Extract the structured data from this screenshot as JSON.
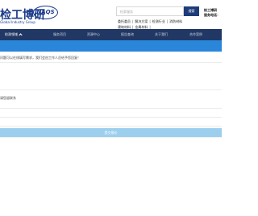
{
  "header": {
    "logo_text": "检工博研",
    "logo_sub": "Global Industry Group",
    "badge": "NAQS",
    "search": {
      "placeholder": "检索服务",
      "button": "搜索"
    },
    "hot_links_row1": [
      "委托委员",
      "解决方案",
      "检测行业",
      "消防材料"
    ],
    "hot_links_row2": [
      "建筑材料",
      "金属材料"
    ],
    "contact_line1": "检工博研",
    "contact_line2": "服务电话："
  },
  "nav": {
    "items": [
      {
        "label": "检测领域",
        "active": true
      },
      {
        "label": "服务项目"
      },
      {
        "label": "资源中心"
      },
      {
        "label": "报告查询"
      },
      {
        "label": "关于我们"
      },
      {
        "label": "合作案例"
      }
    ]
  },
  "form": {
    "description": "问题可以在线填写需求，我们会由工作人员给予您回复！",
    "contact_label": "请您留联系",
    "submit": "提交报价"
  }
}
